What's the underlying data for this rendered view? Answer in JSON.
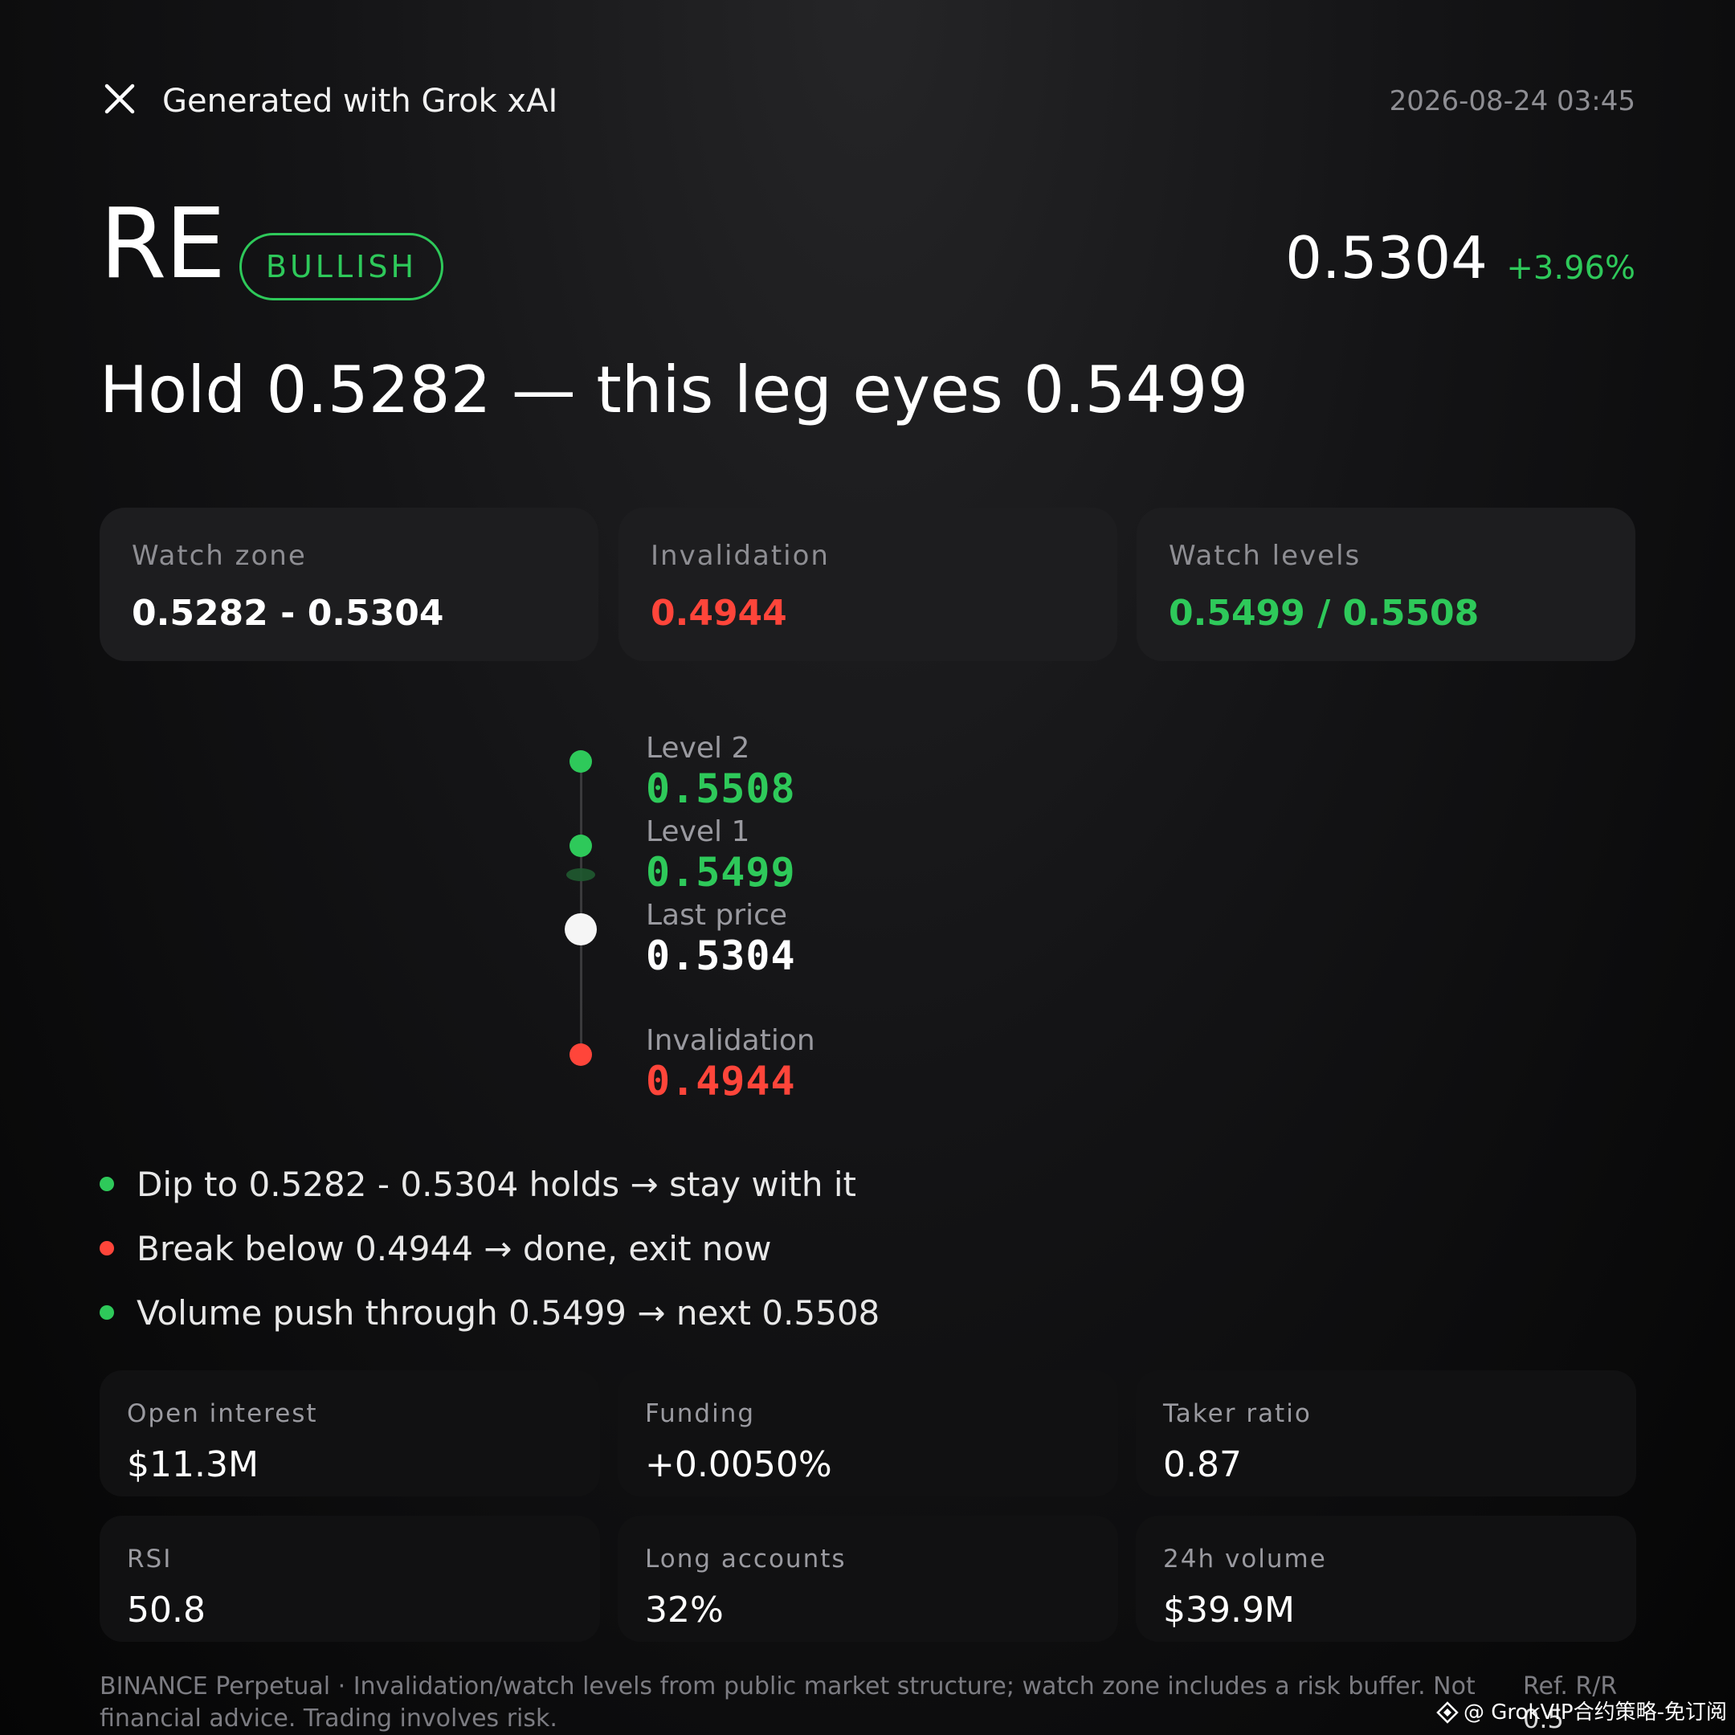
{
  "header": {
    "title": "Generated with Grok xAI",
    "timestamp": "2026-08-24 03:45",
    "close_icon": "close-icon"
  },
  "ticker": {
    "symbol": "RE",
    "sentiment": "BULLISH",
    "price": "0.5304",
    "change": "+3.96%"
  },
  "headline": "Hold 0.5282 — this leg eyes 0.5499",
  "cards": [
    {
      "label": "Watch zone",
      "value": "0.5282 - 0.5304"
    },
    {
      "label": "Invalidation",
      "value": "0.4944"
    },
    {
      "label": "Watch levels",
      "value": "0.5499 / 0.5508"
    }
  ],
  "ladder": [
    {
      "label": "Level 2",
      "value": "0.5508"
    },
    {
      "label": "Level 1",
      "value": "0.5499"
    },
    {
      "label": "Last price",
      "value": "0.5304"
    },
    {
      "label": "Invalidation",
      "value": "0.4944"
    }
  ],
  "bullets": [
    {
      "text": "Dip to 0.5282 - 0.5304 holds → stay with it",
      "status": "green"
    },
    {
      "text": "Break below 0.4944 → done, exit now",
      "status": "red"
    },
    {
      "text": "Volume push through 0.5499 → next 0.5508",
      "status": "green"
    }
  ],
  "stats": [
    {
      "label": "Open interest",
      "value": "$11.3M"
    },
    {
      "label": "Funding",
      "value": "+0.0050%"
    },
    {
      "label": "Taker ratio",
      "value": "0.87"
    },
    {
      "label": "RSI",
      "value": "50.8"
    },
    {
      "label": "Long accounts",
      "value": "32%"
    },
    {
      "label": "24h volume",
      "value": "$39.9M"
    }
  ],
  "footer": {
    "disclaimer": "BINANCE Perpetual · Invalidation/watch levels from public market structure; watch zone includes a risk buffer. Not financial advice. Trading involves risk.",
    "ref_label": "Ref. R/R",
    "ref_value": "0.5"
  },
  "watermark": {
    "text": "@ GrokVIP合约策略-免订阅",
    "icon": "diamond-logo-icon"
  },
  "colors": {
    "green": "#2ec95a",
    "red": "#ff453a",
    "white": "#ffffff",
    "muted": "#8e8e93"
  }
}
